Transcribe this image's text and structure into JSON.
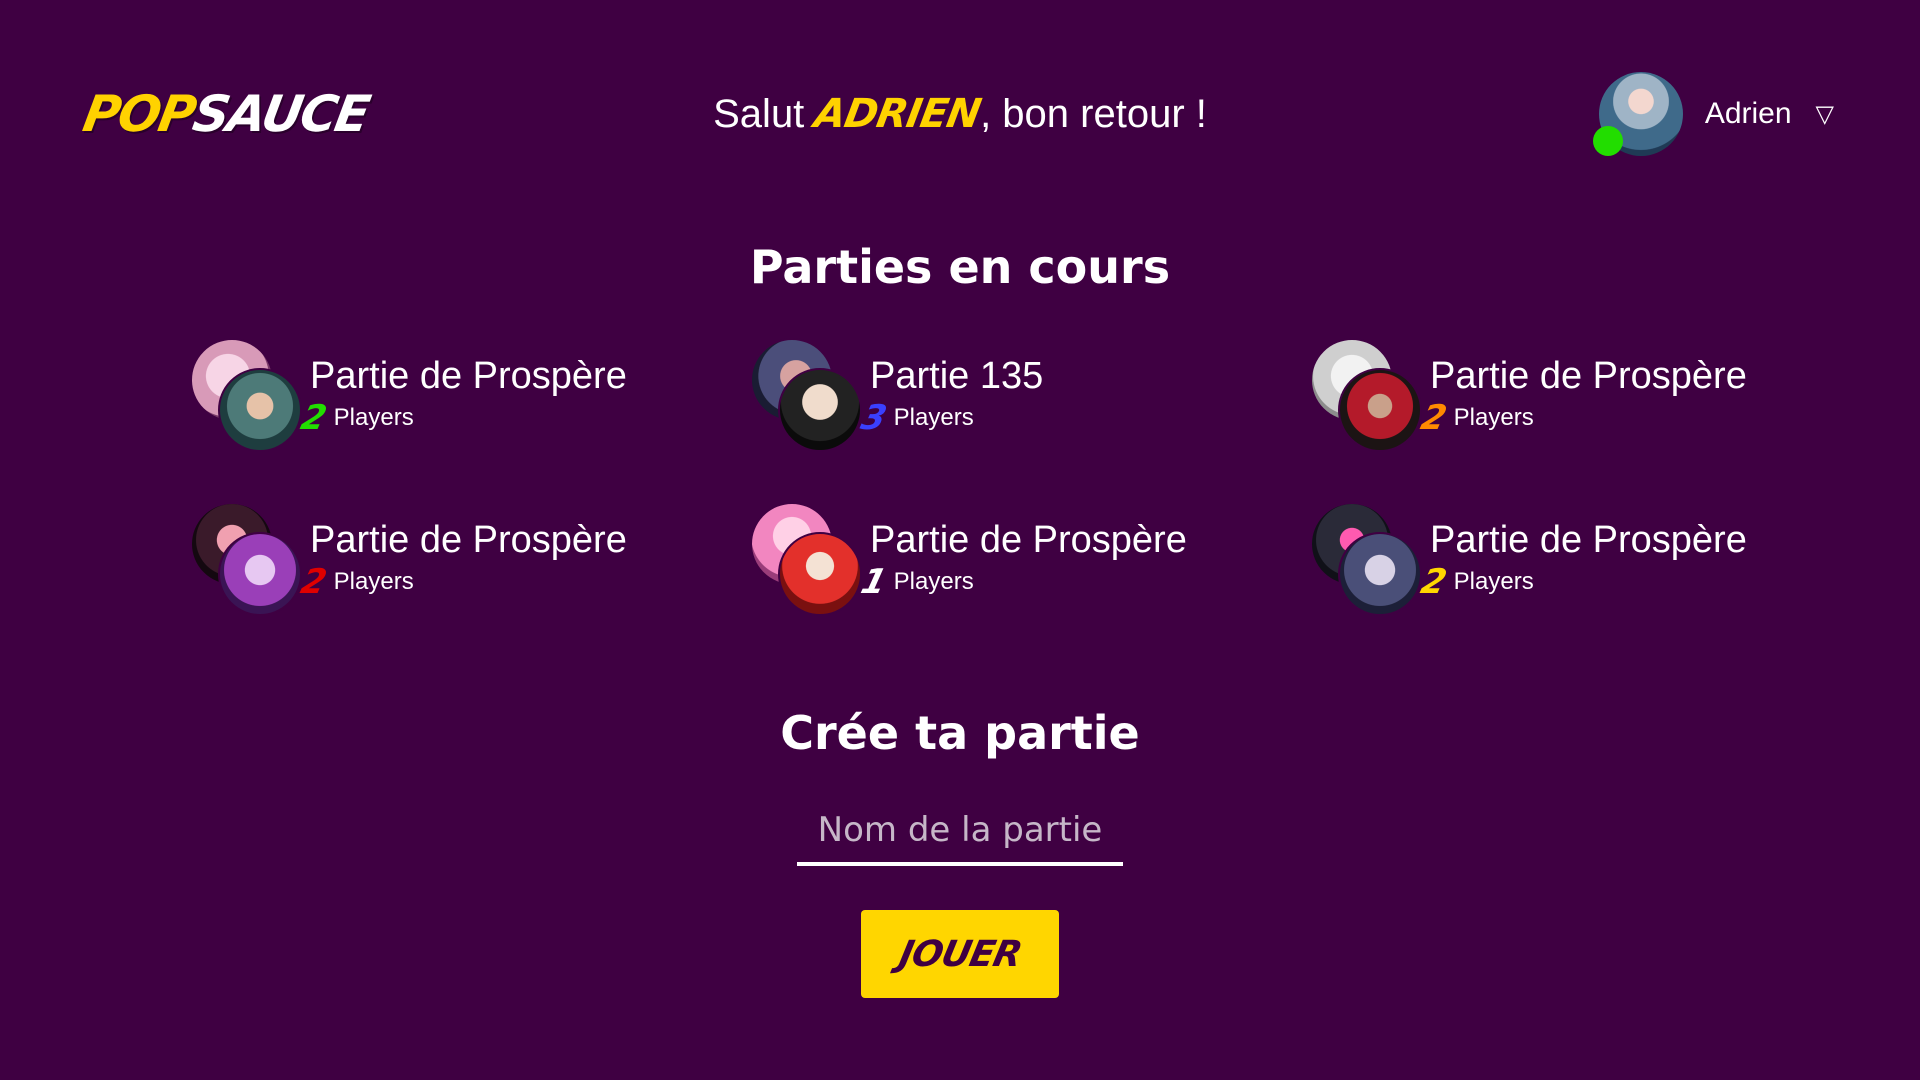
{
  "header": {
    "logo_part1": "POP",
    "logo_part2": "SAUCE",
    "greeting_prefix": "Salut ",
    "greeting_name": "ADRIEN",
    "greeting_suffix": ", bon retour !"
  },
  "user": {
    "name": "Adrien",
    "status_color": "#22dd00"
  },
  "games_section": {
    "title": "Parties en cours",
    "players_label": "Players"
  },
  "games": [
    {
      "title": "Partie de Prospère",
      "count": "2",
      "count_color": "#22dd00"
    },
    {
      "title": "Partie 135",
      "count": "3",
      "count_color": "#3a40ff"
    },
    {
      "title": "Partie de Prospère",
      "count": "2",
      "count_color": "#ff8a00"
    },
    {
      "title": "Partie de Prospère",
      "count": "2",
      "count_color": "#e00000"
    },
    {
      "title": "Partie de Prospère",
      "count": "1",
      "count_color": "#ffffff"
    },
    {
      "title": "Partie de Prospère",
      "count": "2",
      "count_color": "#ffd600"
    }
  ],
  "create_section": {
    "title": "Crée ta partie",
    "input_placeholder": "Nom de la partie",
    "play_label": "JOUER"
  },
  "colors": {
    "background": "#3f0042",
    "accent": "#ffd600"
  }
}
